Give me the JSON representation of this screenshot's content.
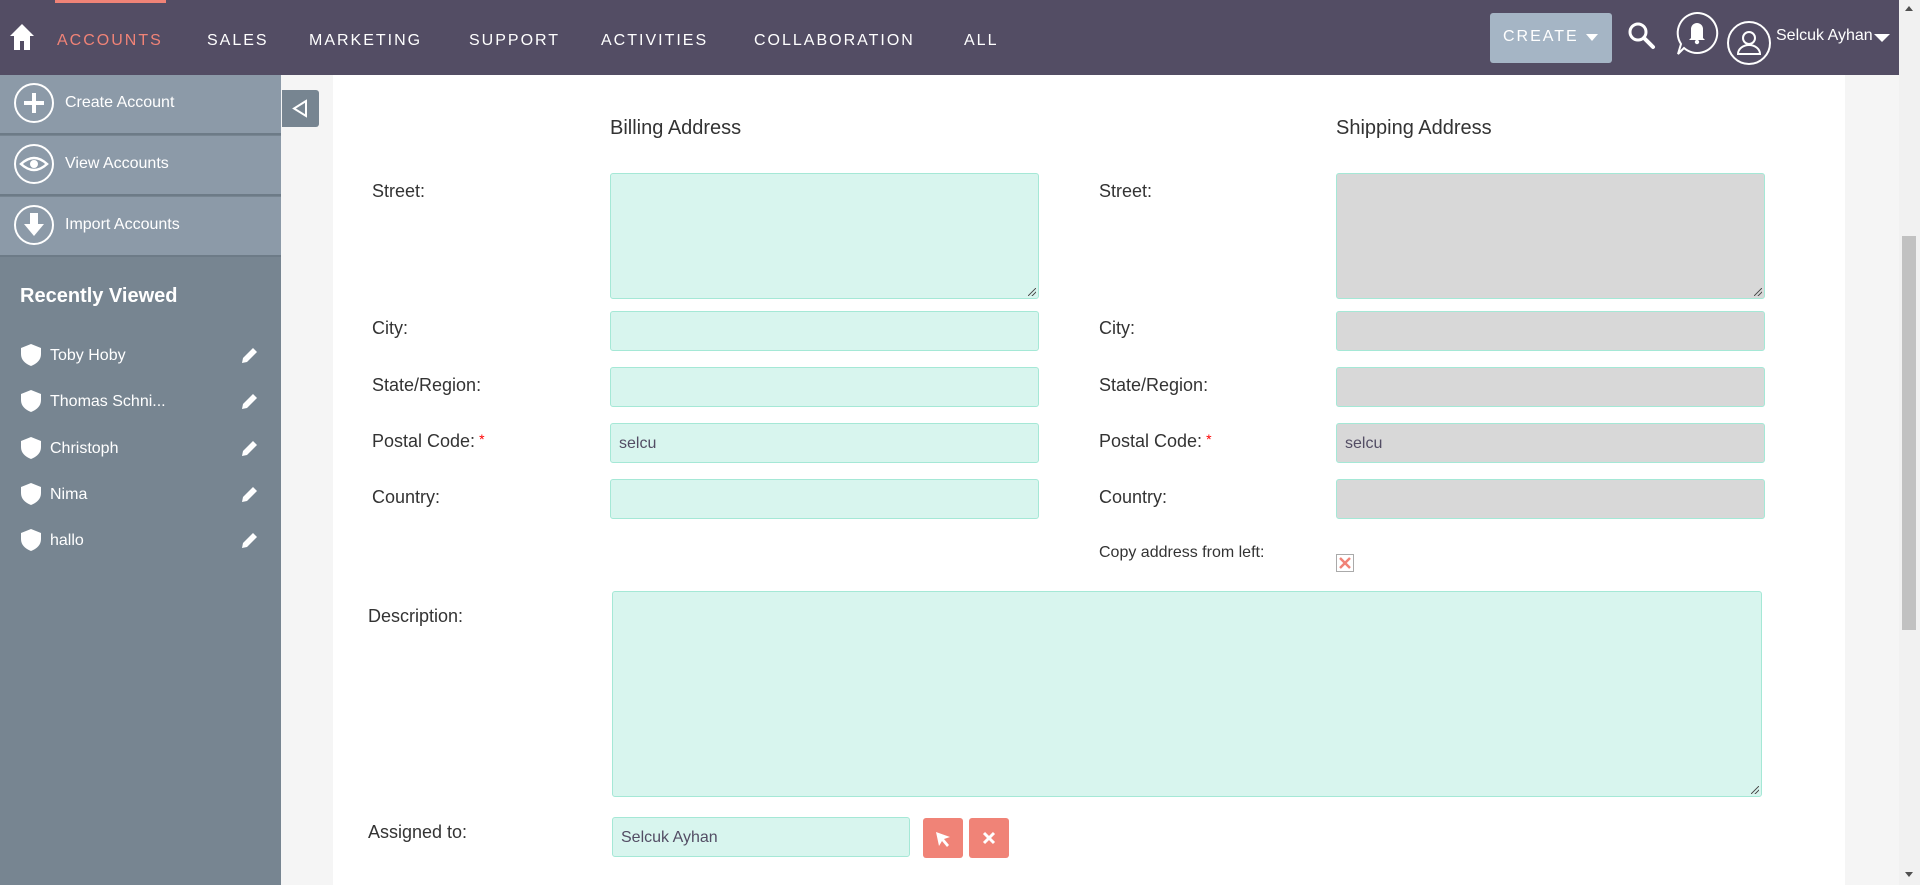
{
  "nav": {
    "items": [
      "ACCOUNTS",
      "SALES",
      "MARKETING",
      "SUPPORT",
      "ACTIVITIES",
      "COLLABORATION",
      "ALL"
    ],
    "active": "ACCOUNTS",
    "create_label": "CREATE",
    "user_name": "Selcuk Ayhan"
  },
  "sidebar": {
    "actions": [
      {
        "label": "Create Account",
        "icon": "plus-icon"
      },
      {
        "label": "View Accounts",
        "icon": "eye-icon"
      },
      {
        "label": "Import Accounts",
        "icon": "download-icon"
      }
    ],
    "recently_viewed_title": "Recently Viewed",
    "recently_viewed": [
      "Toby Hoby",
      "Thomas Schni...",
      "Christoph",
      "Nima",
      "hallo"
    ]
  },
  "form": {
    "billing_title": "Billing Address",
    "shipping_title": "Shipping Address",
    "labels": {
      "street": "Street:",
      "city": "City:",
      "state": "State/Region:",
      "postal": "Postal Code:",
      "country": "Country:",
      "copy": "Copy address from left:",
      "description": "Description:",
      "assigned": "Assigned to:"
    },
    "required_mark": "*",
    "billing": {
      "street": "",
      "city": "",
      "state": "",
      "postal": "selcu",
      "country": ""
    },
    "shipping": {
      "street": "",
      "city": "",
      "state": "",
      "postal": "selcu",
      "country": ""
    },
    "description": "",
    "assigned_to": "Selcuk Ayhan"
  },
  "colors": {
    "nav_bg": "#534d64",
    "accent": "#f08377",
    "field_bg": "#d8f5ee",
    "field_disabled_bg": "#d8d8d8",
    "sidebar_bg": "#778591"
  }
}
